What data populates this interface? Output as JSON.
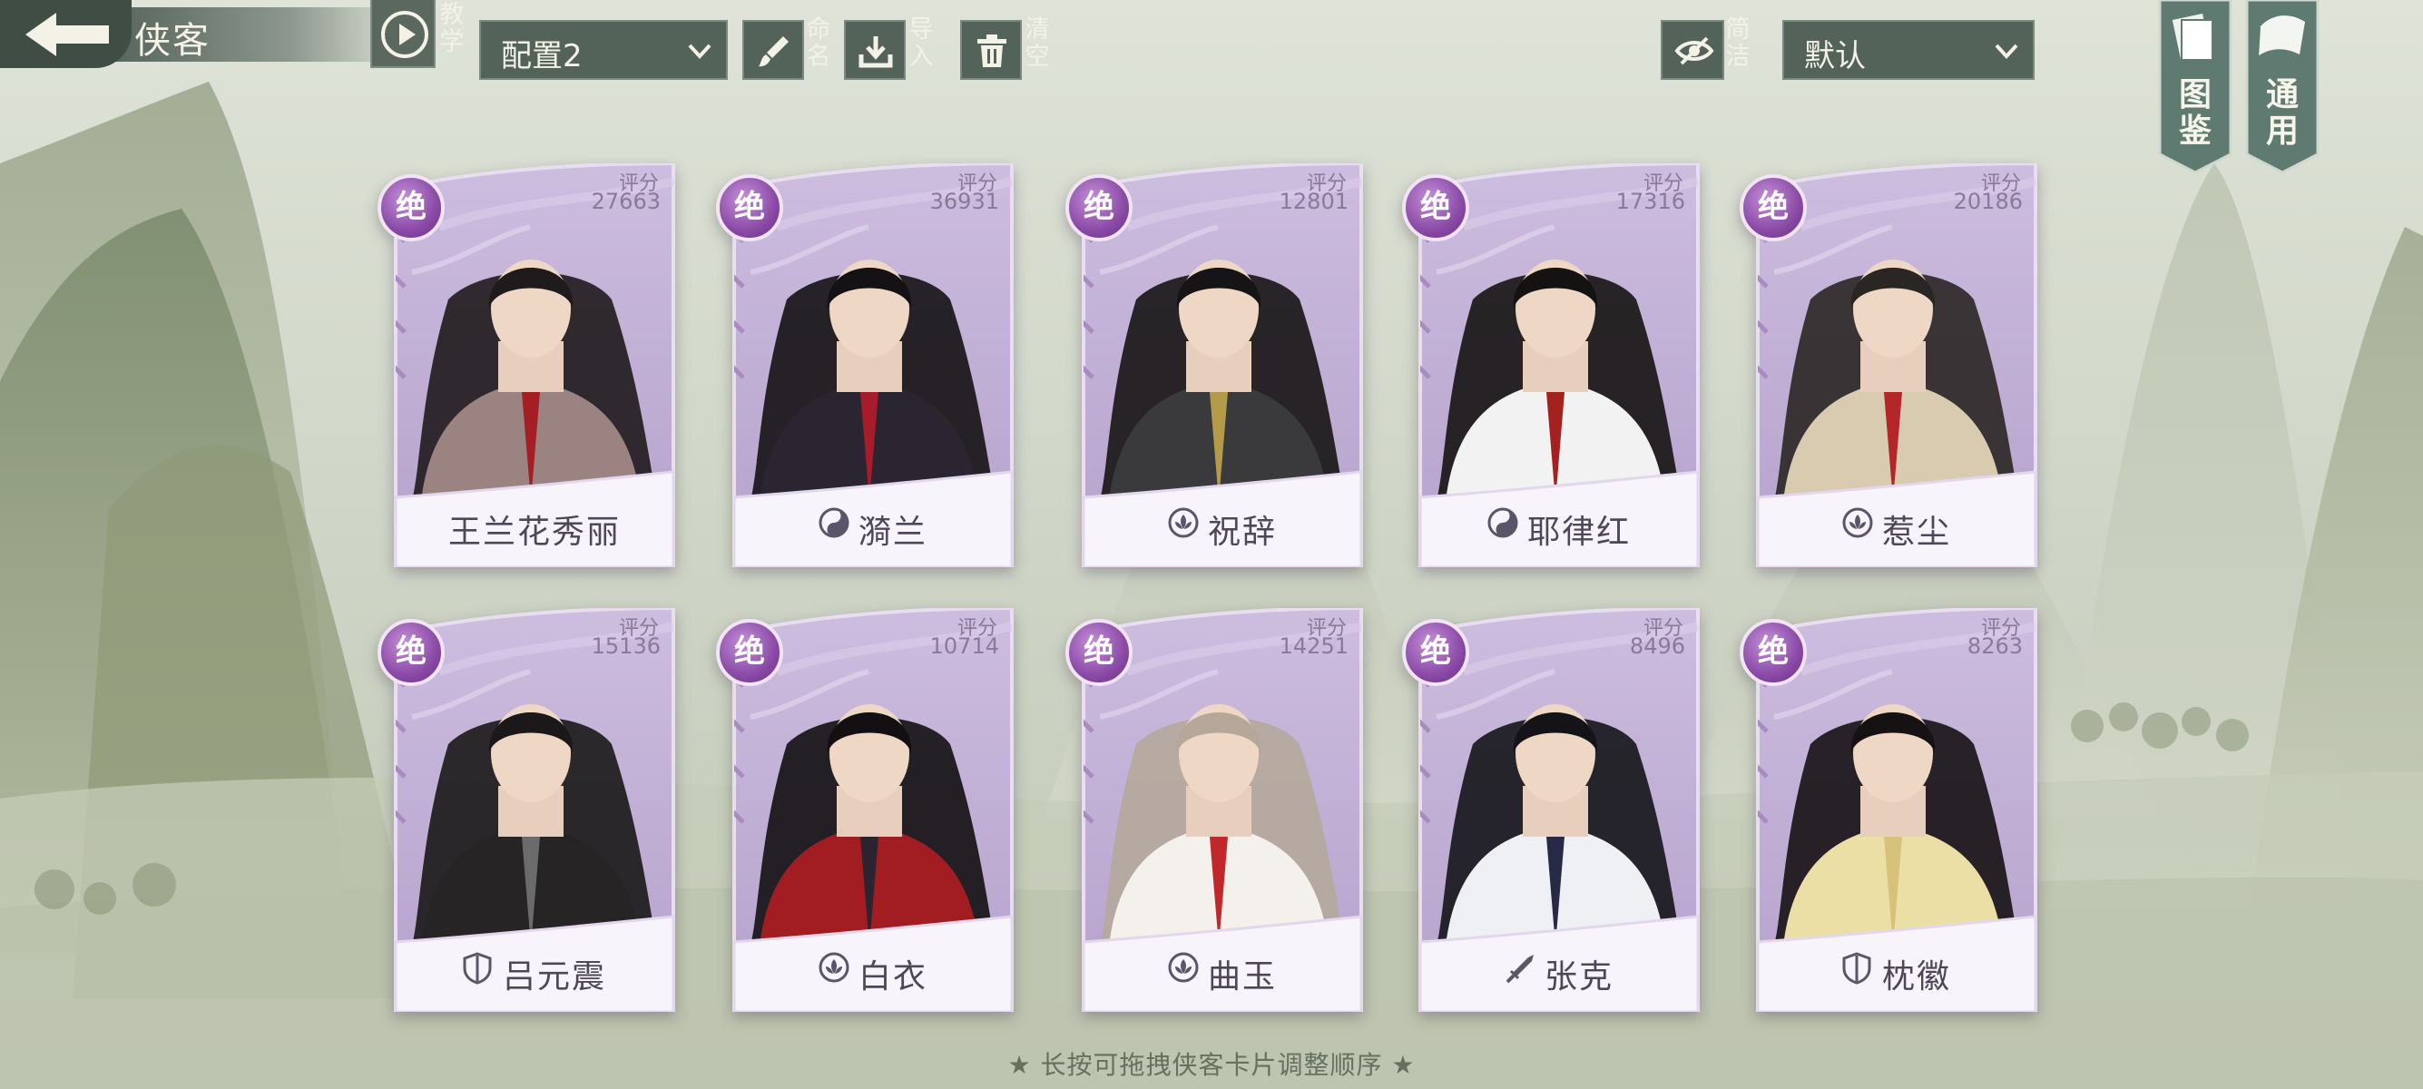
{
  "header": {
    "title": "侠客",
    "tutorial_label": "教学",
    "config_select": {
      "value": "配置2"
    },
    "rename_label": "命名",
    "import_label": "导入",
    "clear_label": "清空",
    "simple_label": "简洁",
    "sort_select": {
      "value": "默认"
    },
    "atlas_label": "图鉴",
    "general_label": "通用"
  },
  "score_label": "评分",
  "rarity_label": "绝",
  "cards": [
    {
      "name": "王兰花秀丽",
      "score": "27663",
      "faction_icon": "none",
      "hair": "#1f1a1c",
      "robe": "#9a8381",
      "accent": "#a31f24"
    },
    {
      "name": "漪兰",
      "score": "36931",
      "faction_icon": "yin-yang-icon",
      "hair": "#141214",
      "robe": "#2a2530",
      "accent": "#a61c2b"
    },
    {
      "name": "祝辞",
      "score": "12801",
      "faction_icon": "lotus-icon",
      "hair": "#161414",
      "robe": "#3a3a3c",
      "accent": "#b49a4b"
    },
    {
      "name": "耶律红",
      "score": "17316",
      "faction_icon": "yin-yang-icon",
      "hair": "#151312",
      "robe": "#f2f2f2",
      "accent": "#a32220"
    },
    {
      "name": "惹尘",
      "score": "20186",
      "faction_icon": "lotus-icon",
      "hair": "#2a2624",
      "robe": "#d8cbb0",
      "accent": "#b3262a"
    },
    {
      "name": "吕元震",
      "score": "15136",
      "faction_icon": "shield-icon",
      "hair": "#1a1818",
      "robe": "#262425",
      "accent": "#6b6b6b"
    },
    {
      "name": "白衣",
      "score": "10714",
      "faction_icon": "lotus-icon",
      "hair": "#121012",
      "robe": "#a11d22",
      "accent": "#2b2330"
    },
    {
      "name": "曲玉",
      "score": "14251",
      "faction_icon": "lotus-icon",
      "hair": "#b5a89b",
      "robe": "#f4f1ec",
      "accent": "#c0282c"
    },
    {
      "name": "张克",
      "score": "8496",
      "faction_icon": "sword-icon",
      "hair": "#141418",
      "robe": "#eef0f4",
      "accent": "#262a44"
    },
    {
      "name": "枕徽",
      "score": "8263",
      "faction_icon": "shield-icon",
      "hair": "#161214",
      "robe": "#ecdfa6",
      "accent": "#d6c27a"
    }
  ],
  "footer": {
    "hint": "★ 长按可拖拽侠客卡片调整顺序 ★"
  },
  "colors": {
    "card_purple": "#bdaad2",
    "badge_purple": "#8a4aa6",
    "toolbar_green": "#53635a"
  }
}
